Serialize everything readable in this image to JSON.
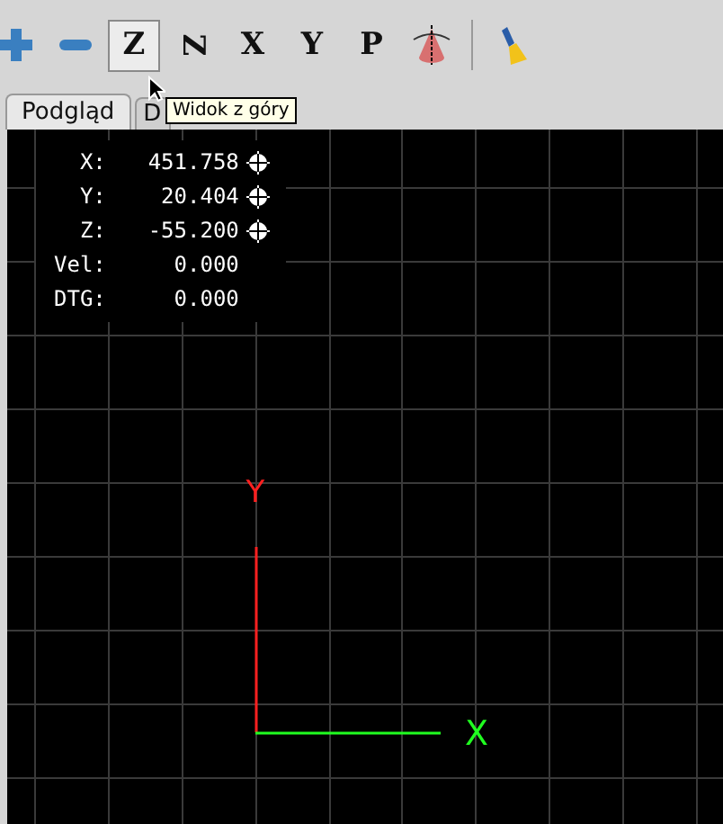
{
  "toolbar": [
    {
      "kind": "zoom-in"
    },
    {
      "kind": "zoom-out"
    },
    {
      "kind": "view",
      "label": "Z",
      "selected": true
    },
    {
      "kind": "view-rotated",
      "label": "Z",
      "selected": false
    },
    {
      "kind": "view",
      "label": "X",
      "selected": false
    },
    {
      "kind": "view",
      "label": "Y",
      "selected": false
    },
    {
      "kind": "view-perspective",
      "label": "P",
      "selected": false
    },
    {
      "kind": "cone"
    },
    {
      "kind": "separator"
    },
    {
      "kind": "clear"
    }
  ],
  "tabs": [
    {
      "label": "Podgląd",
      "selected": true
    },
    {
      "label": "D",
      "selected": false
    }
  ],
  "tooltip": "Widok z góry",
  "dro": [
    {
      "label": "X:",
      "value": "451.758",
      "homed": true
    },
    {
      "label": "Y:",
      "value": "20.404",
      "homed": true
    },
    {
      "label": "Z:",
      "value": "-55.200",
      "homed": true
    },
    {
      "label": "Vel:",
      "value": "0.000",
      "homed": false
    },
    {
      "label": "DTG:",
      "value": "0.000",
      "homed": false
    }
  ],
  "axes": {
    "x_label": "X",
    "y_label": "Y"
  }
}
